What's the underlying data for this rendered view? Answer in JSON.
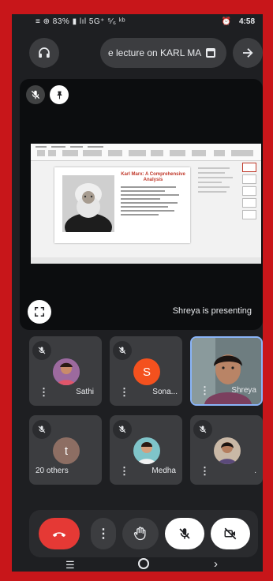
{
  "status_bar": {
    "left": "≡ ⊕ 83% ▮ lıl 5G⁺ ⁵⁄₆ ᵏᵇ",
    "time": "4:58",
    "alarm_icon": "alarm-icon"
  },
  "top_bar": {
    "meeting_title": "e lecture on KARL MA",
    "audio_icon": "headphones-icon",
    "calendar_icon": "calendar-icon",
    "leave_icon": "arrow-right-icon"
  },
  "presentation": {
    "presenting_label": "Shreya is presenting",
    "slide": {
      "title": "Karl Marx: A Comprehensive Analysis"
    }
  },
  "participants": [
    {
      "name": "Sathi",
      "muted": true,
      "avatar_type": "photo"
    },
    {
      "name": "Sona...",
      "muted": true,
      "avatar_type": "initial",
      "initial": "S",
      "avatar_color": "#f4511e"
    },
    {
      "name": "Shreya",
      "muted": false,
      "avatar_type": "video"
    },
    {
      "name": "20 others",
      "muted": true,
      "avatar_type": "initial",
      "initial": "t",
      "avatar_color": "#8d6e63"
    },
    {
      "name": "Medha",
      "muted": true,
      "avatar_type": "photo"
    },
    {
      "name": ".",
      "muted": true,
      "avatar_type": "photo"
    }
  ],
  "controls": {
    "end_call_icon": "end-call-icon",
    "more_icon": "more-vertical-icon",
    "raise_hand_icon": "raise-hand-icon",
    "mic_icon": "mic-off-icon",
    "camera_icon": "camera-off-icon"
  },
  "colors": {
    "frame": "#c8161a",
    "end_call": "#e53935",
    "background": "#1e1f22",
    "tile": "#3c3d40"
  }
}
